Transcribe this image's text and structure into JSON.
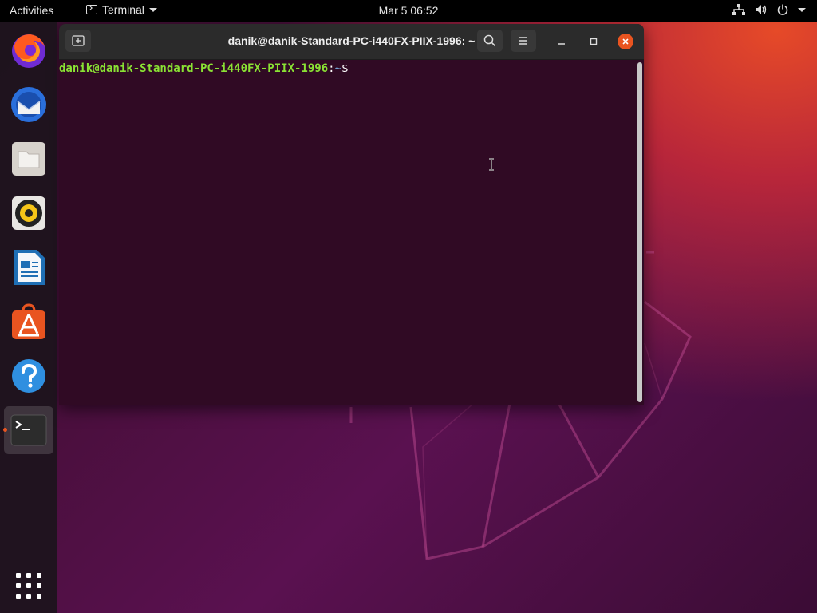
{
  "topbar": {
    "activities_label": "Activities",
    "app_menu_label": "Terminal",
    "clock": "Mar 5  06:52",
    "tray_icons": [
      "network-icon",
      "volume-icon",
      "power-icon",
      "chevron-down-icon"
    ]
  },
  "dock": {
    "items": [
      {
        "name": "firefox",
        "icon": "firefox-icon"
      },
      {
        "name": "thunderbird",
        "icon": "thunderbird-icon"
      },
      {
        "name": "files",
        "icon": "files-icon"
      },
      {
        "name": "rhythmbox",
        "icon": "rhythmbox-icon"
      },
      {
        "name": "libreoffice-writer",
        "icon": "writer-icon"
      },
      {
        "name": "ubuntu-software",
        "icon": "software-icon"
      },
      {
        "name": "help",
        "icon": "help-icon"
      },
      {
        "name": "terminal",
        "icon": "terminal-icon",
        "running": true,
        "active": true
      }
    ],
    "show_apps_icon": "app-grid-icon"
  },
  "window": {
    "title": "danik@danik-Standard-PC-i440FX-PIIX-1996: ~",
    "prompt": {
      "user_host": "danik@danik-Standard-PC-i440FX-PIIX-1996",
      "separator": ":",
      "path": "~",
      "symbol": "$"
    }
  },
  "colors": {
    "accent": "#e95420",
    "terminal_bg": "#300a24",
    "prompt_user": "#8ae234",
    "prompt_path": "#729fcf"
  }
}
